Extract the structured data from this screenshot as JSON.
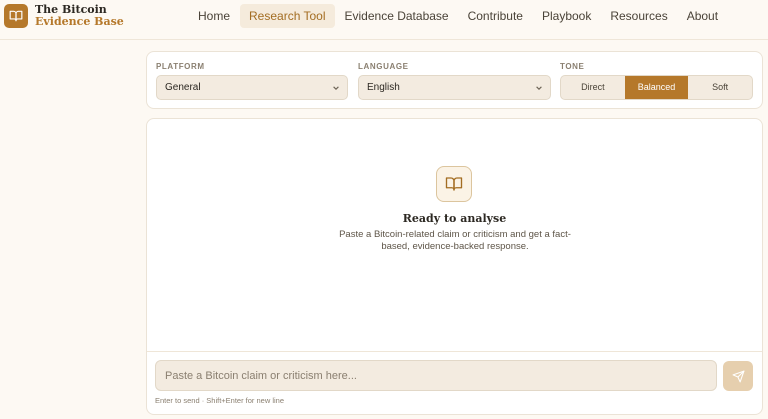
{
  "brand": {
    "line1": "The Bitcoin",
    "line2": "Evidence Base",
    "icon": "book-open-icon"
  },
  "nav": {
    "items": [
      {
        "label": "Home",
        "active": false
      },
      {
        "label": "Research Tool",
        "active": true
      },
      {
        "label": "Evidence Database",
        "active": false
      },
      {
        "label": "Contribute",
        "active": false
      },
      {
        "label": "Playbook",
        "active": false
      },
      {
        "label": "Resources",
        "active": false
      },
      {
        "label": "About",
        "active": false
      }
    ]
  },
  "settings": {
    "platform": {
      "label": "PLATFORM",
      "value": "General"
    },
    "language": {
      "label": "LANGUAGE",
      "value": "English"
    },
    "tone": {
      "label": "TONE",
      "options": [
        "Direct",
        "Balanced",
        "Soft"
      ],
      "selected": "Balanced"
    }
  },
  "empty_state": {
    "icon": "book-open-icon",
    "title": "Ready to analyse",
    "description": "Paste a Bitcoin-related claim or criticism and get a fact-based, evidence-backed response."
  },
  "composer": {
    "placeholder": "Paste a Bitcoin claim or criticism here...",
    "value": "",
    "hint": "Enter to send · Shift+Enter for new line",
    "send_icon": "send-icon"
  },
  "colors": {
    "accent": "#b5782a",
    "background": "#fdf9f3",
    "card": "#ffffff",
    "field": "#f3ebe0"
  }
}
